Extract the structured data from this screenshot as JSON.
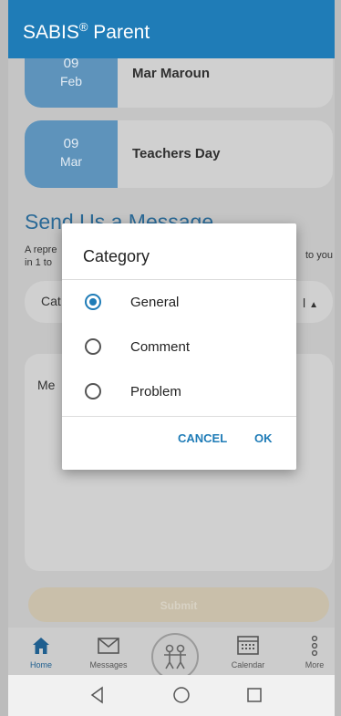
{
  "appbar": {
    "title": "SABIS",
    "reg": "®",
    "title_suffix": " Parent"
  },
  "events": [
    {
      "day": "09",
      "month": "Feb",
      "title": "Mar Maroun"
    },
    {
      "day": "09",
      "month": "Mar",
      "title": "Teachers Day"
    }
  ],
  "message_section": {
    "title": "Send Us a Message",
    "desc_left_1": "A repre",
    "desc_left_2": "in 1 to",
    "desc_right": "to you",
    "category_label": "Cat",
    "category_suffix": "l",
    "message_label": "Me",
    "submit_label": "Submit"
  },
  "dialog": {
    "title": "Category",
    "options": [
      {
        "label": "General",
        "selected": true
      },
      {
        "label": "Comment",
        "selected": false
      },
      {
        "label": "Problem",
        "selected": false
      }
    ],
    "cancel_label": "CANCEL",
    "ok_label": "OK"
  },
  "bottom_nav": {
    "items": [
      {
        "label": "Home",
        "icon": "home-icon",
        "active": true
      },
      {
        "label": "Messages",
        "icon": "envelope-icon",
        "active": false
      },
      {
        "label": "Calendar",
        "icon": "calendar-icon",
        "active": false
      },
      {
        "label": "More",
        "icon": "more-vertical-icon",
        "active": false
      }
    ]
  },
  "system_nav": {
    "icons": [
      "back-icon",
      "home-circle-icon",
      "recents-icon"
    ]
  },
  "colors": {
    "primary": "#1f7cb7",
    "date_block": "#5e93bb",
    "scrim_content": "#c5c5c5"
  }
}
